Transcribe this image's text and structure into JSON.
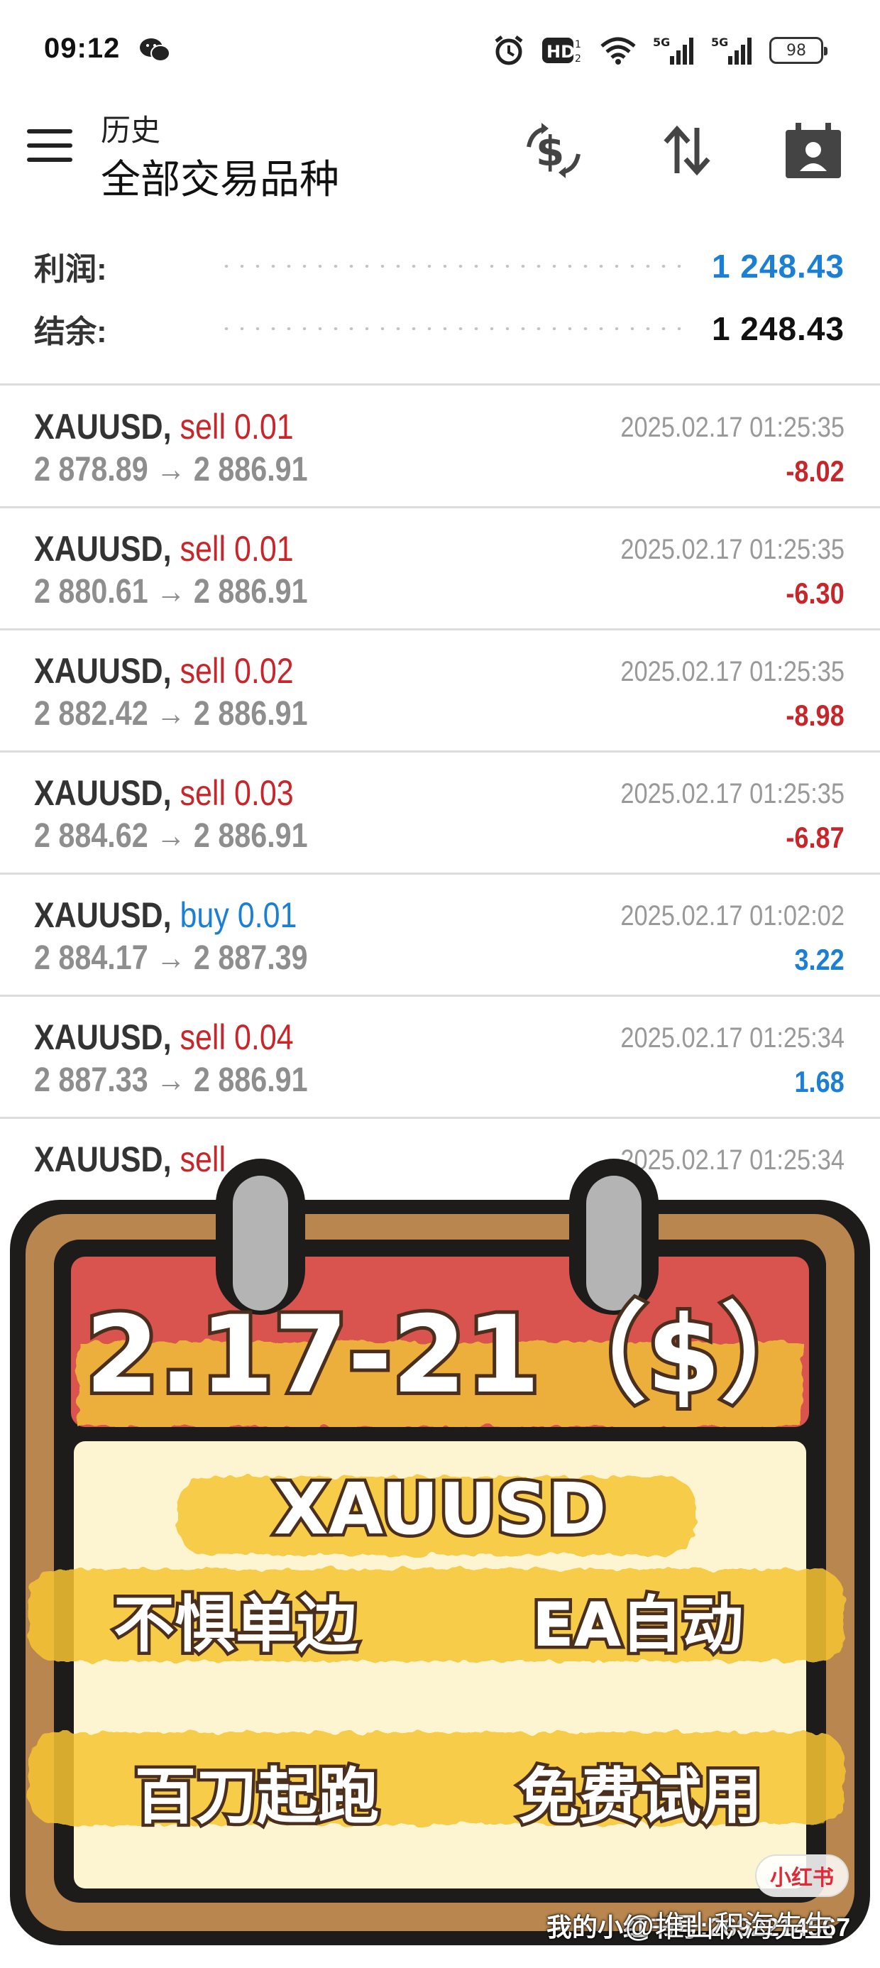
{
  "status_bar": {
    "time": "09:12",
    "battery": "98",
    "icons": [
      "wechat-icon",
      "alarm-icon",
      "hd-icon",
      "wifi-icon",
      "5g-signal-icon",
      "5g-signal-icon",
      "battery-icon"
    ]
  },
  "app_bar": {
    "subtitle": "历史",
    "title": "全部交易品种",
    "actions": [
      "deposit-icon",
      "sort-icon",
      "calendar-icon"
    ]
  },
  "summary": {
    "profit_label": "利润:",
    "profit_value": "1 248.43",
    "balance_label": "结余:",
    "balance_value": "1 248.43"
  },
  "trades": [
    {
      "symbol": "XAUUSD,",
      "side": "sell 0.01",
      "prices": "2 878.89 → 2 886.91",
      "time": "2025.02.17 01:25:35",
      "pl": "-8.02",
      "type": "sell"
    },
    {
      "symbol": "XAUUSD,",
      "side": "sell 0.01",
      "prices": "2 880.61 → 2 886.91",
      "time": "2025.02.17 01:25:35",
      "pl": "-6.30",
      "type": "sell"
    },
    {
      "symbol": "XAUUSD,",
      "side": "sell 0.02",
      "prices": "2 882.42 → 2 886.91",
      "time": "2025.02.17 01:25:35",
      "pl": "-8.98",
      "type": "sell"
    },
    {
      "symbol": "XAUUSD,",
      "side": "sell 0.03",
      "prices": "2 884.62 → 2 886.91",
      "time": "2025.02.17 01:25:35",
      "pl": "-6.87",
      "type": "sell"
    },
    {
      "symbol": "XAUUSD,",
      "side": "buy 0.01",
      "prices": "2 884.17 → 2 887.39",
      "time": "2025.02.17 01:02:02",
      "pl": "3.22",
      "type": "buy"
    },
    {
      "symbol": "XAUUSD,",
      "side": "sell 0.04",
      "prices": "2 887.33 → 2 886.91",
      "time": "2025.02.17 01:25:34",
      "pl": "1.68",
      "type": "sell"
    },
    {
      "symbol": "XAUUSD,",
      "side": "sell",
      "prices": "",
      "time": "2025.02.17 01:25:34",
      "pl": "",
      "type": "sell"
    }
  ],
  "sticker": {
    "header": "2.17-21（$）",
    "line1": "XAUUSD",
    "line2_left": "不惧单边",
    "line2_right": "EA自动",
    "line3_left": "百刀起跑",
    "line3_right": "免费试用"
  },
  "watermark": {
    "logo": "小红书",
    "author": "@堆山积海先生",
    "id_text": "我的小红书号:2692214567"
  },
  "colors": {
    "sell": "#c8262b",
    "buy": "#1b7fd6",
    "calendar_frame": "#b8864e",
    "calendar_header": "#d9534f",
    "calendar_body": "#fdf5d2",
    "highlight": "#f7c531"
  }
}
